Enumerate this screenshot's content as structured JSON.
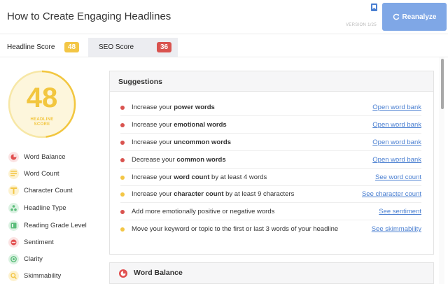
{
  "header": {
    "title": "How to Create Engaging Headlines",
    "version": "VERSION 1/25",
    "reanalyze_label": "Reanalyze",
    "accent_color": "#7fa7e6"
  },
  "tabs": [
    {
      "label": "Headline Score",
      "badge": "48",
      "badge_color": "#f3c645",
      "active": true
    },
    {
      "label": "SEO Score",
      "badge": "36",
      "badge_color": "#d9534f",
      "active": false
    }
  ],
  "score": {
    "value": "48",
    "label_line1": "HEADLINE",
    "label_line2": "SCORE",
    "fill_fraction": 0.48,
    "color": "#f2c63f"
  },
  "metrics": [
    {
      "label": "Word Balance",
      "icon": "pie-icon",
      "color": "#e14e4e"
    },
    {
      "label": "Word Count",
      "icon": "lines-icon",
      "color": "#f3c645"
    },
    {
      "label": "Character Count",
      "icon": "text-t-icon",
      "color": "#f3c645"
    },
    {
      "label": "Headline Type",
      "icon": "cluster-icon",
      "color": "#5bbd7a"
    },
    {
      "label": "Reading Grade Level",
      "icon": "book-icon",
      "color": "#5bbd7a"
    },
    {
      "label": "Sentiment",
      "icon": "face-icon",
      "color": "#e14e4e"
    },
    {
      "label": "Clarity",
      "icon": "target-icon",
      "color": "#5bbd7a"
    },
    {
      "label": "Skimmability",
      "icon": "search-icon",
      "color": "#f3c645"
    }
  ],
  "suggestions": {
    "title": "Suggestions",
    "items": [
      {
        "pre": "Increase your ",
        "bold": "power words",
        "post": "",
        "link": "Open word bank",
        "color": "#d9534f"
      },
      {
        "pre": "Increase your ",
        "bold": "emotional words",
        "post": "",
        "link": "Open word bank",
        "color": "#d9534f"
      },
      {
        "pre": "Increase your ",
        "bold": "uncommon words",
        "post": "",
        "link": "Open word bank",
        "color": "#d9534f"
      },
      {
        "pre": "Decrease your ",
        "bold": "common words",
        "post": "",
        "link": "Open word bank",
        "color": "#d9534f"
      },
      {
        "pre": "Increase your ",
        "bold": "word count",
        "post": " by at least 4 words",
        "link": "See word count",
        "color": "#f3c645"
      },
      {
        "pre": "Increase your ",
        "bold": "character count",
        "post": " by at least 9 characters",
        "link": "See character count",
        "color": "#f3c645"
      },
      {
        "pre": "Add more emotionally positive or negative words",
        "bold": "",
        "post": "",
        "link": "See sentiment",
        "color": "#d9534f"
      },
      {
        "pre": "Move your keyword or topic to the first or last 3 words of your headline",
        "bold": "",
        "post": "",
        "link": "See skimmability",
        "color": "#f3c645"
      }
    ]
  },
  "word_balance": {
    "title": "Word Balance",
    "icon": "pie-icon",
    "color": "#e14e4e"
  }
}
